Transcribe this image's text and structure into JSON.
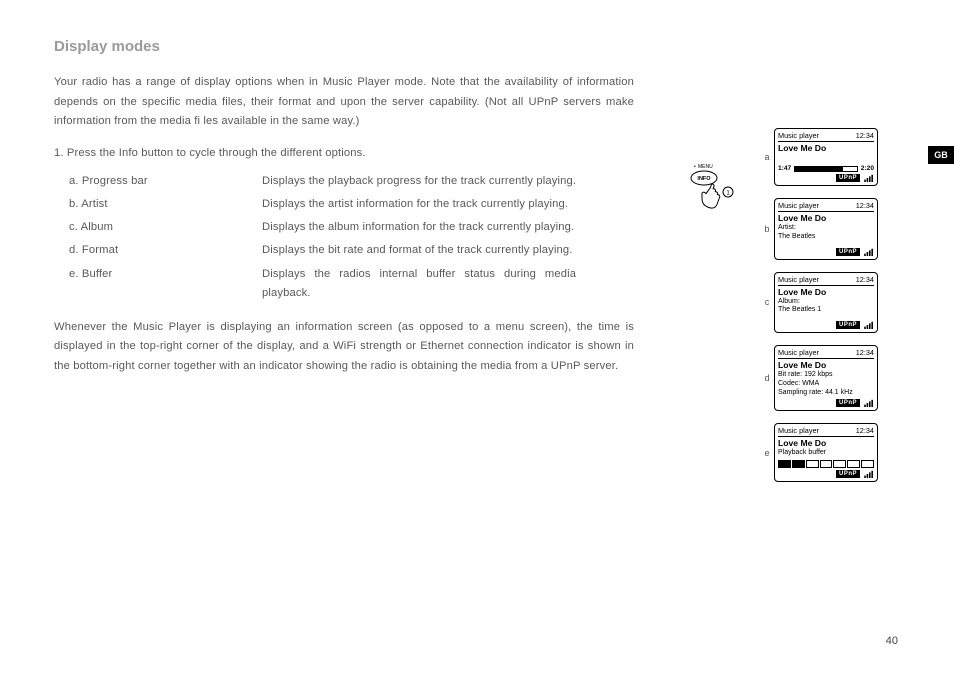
{
  "page_number": "40",
  "locale_tab": "GB",
  "heading": "Display modes",
  "intro": "Your radio has a range of display options when in Music Player mode. Note that the availability of information depends on the specific media files, their format and upon the server capability. (Not all UPnP servers make information from the media fi les available in the same way.)",
  "step1": "1. Press the Info button to cycle through the different options.",
  "options": {
    "a": {
      "label": "a. Progress bar",
      "desc": "Displays the playback progress for the track currently playing."
    },
    "b": {
      "label": "b. Artist",
      "desc": "Displays the artist information for the track currently playing."
    },
    "c": {
      "label": "c. Album",
      "desc": "Displays the album information for the track currently playing."
    },
    "d": {
      "label": "d. Format",
      "desc": "Displays the bit rate and format of the track currently playing."
    },
    "e": {
      "label": "e. Buffer",
      "desc_l1": "Displays the radios internal buffer status during media",
      "desc_l2": "playback."
    }
  },
  "para2": "Whenever the Music Player is displaying an information screen (as opposed to a menu screen), the time is displayed in the top-right corner of the display, and a WiFi strength or Ethernet connection indicator is shown in the bottom-right corner together with an indicator showing the radio is obtaining the media from a UPnP server.",
  "info_button": {
    "menu_label": "MENU",
    "button_label": "INFO",
    "step_badge": "1"
  },
  "screens": {
    "labels": {
      "a": "a",
      "b": "b",
      "c": "c",
      "d": "d",
      "e": "e"
    },
    "common": {
      "header_left": "Music player",
      "header_right": "12:34",
      "title": "Love Me Do",
      "upnp": "UPnP"
    },
    "a": {
      "elapsed": "1:47",
      "total": "2:20",
      "progress_pct": 78
    },
    "b": {
      "line1": "Artist:",
      "line2": "The Beatles"
    },
    "c": {
      "line1": "Album:",
      "line2": "The Beatles 1"
    },
    "d": {
      "line1": "Bit rate: 192 kbps",
      "line2": "Codec: WMA",
      "line3": "Sampling rate: 44.1 kHz"
    },
    "e": {
      "line1": "Playback buffer",
      "buffer_filled": 2,
      "buffer_total": 7
    }
  }
}
